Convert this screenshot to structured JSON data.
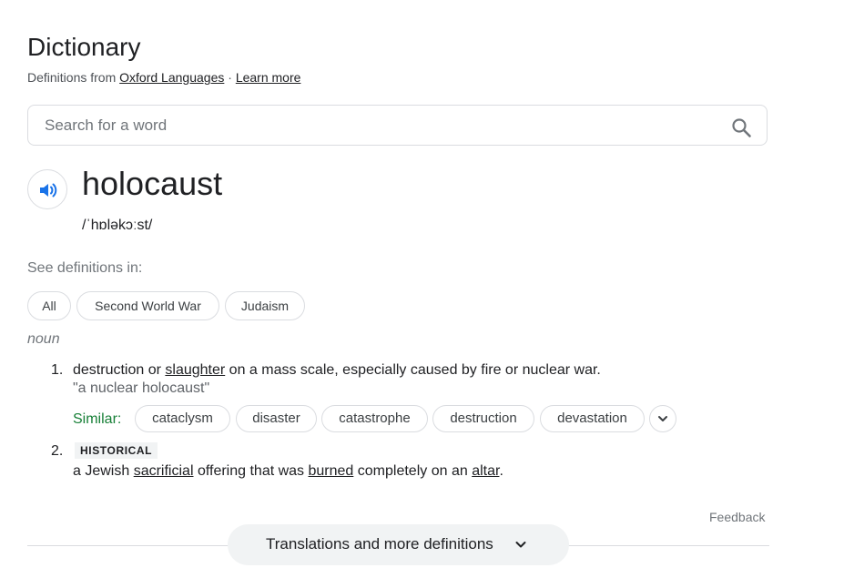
{
  "header": {
    "title": "Dictionary",
    "source_prefix": "Definitions from",
    "source_link": "Oxford Languages",
    "separator": "·",
    "learn_more": "Learn more"
  },
  "search": {
    "placeholder": "Search for a word",
    "icon": "search-icon"
  },
  "entry": {
    "word": "holocaust",
    "phonetic": "/ˈhɒləkɔːst/",
    "speaker_icon": "speaker-icon",
    "see_definitions_label": "See definitions in:",
    "categories": [
      "All",
      "Second World War",
      "Judaism"
    ],
    "part_of_speech": "noun",
    "senses": [
      {
        "number": "1.",
        "definition": {
          "a": "destruction or ",
          "b": "slaughter",
          "c": " on a mass scale, especially caused by fire or nuclear war."
        },
        "example": "\"a nuclear holocaust\"",
        "similar_label": "Similar:",
        "similar": [
          "cataclysm",
          "disaster",
          "catastrophe",
          "destruction",
          "devastation"
        ]
      },
      {
        "number": "2.",
        "label": "HISTORICAL",
        "definition": {
          "a": "a Jewish ",
          "b": "sacrificial",
          "c": " offering that was ",
          "d": "burned",
          "e": " completely on an ",
          "f": "altar",
          "g": "."
        }
      }
    ]
  },
  "footer": {
    "feedback": "Feedback",
    "translations_button": "Translations and more definitions"
  },
  "colors": {
    "accent_blue": "#1a73e8",
    "similar_green": "#188038",
    "border": "#dadce0"
  }
}
